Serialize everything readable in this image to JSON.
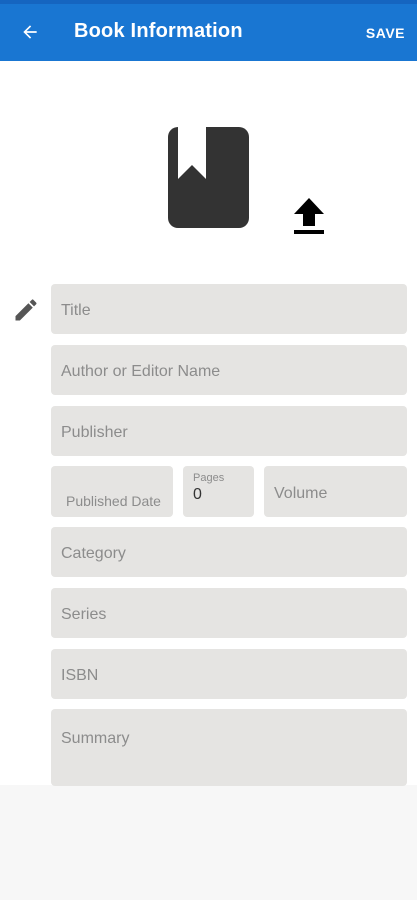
{
  "appbar": {
    "back_icon": "arrow-left-icon",
    "title": "Book Information",
    "save_label": "SAVE",
    "background": "#1976d2"
  },
  "cover": {
    "icon": "book-bookmark-icon",
    "upload_icon": "upload-icon"
  },
  "form": {
    "edit_icon": "pencil-icon",
    "title_placeholder": "Title",
    "author_placeholder": "Author or Editor Name",
    "publisher_placeholder": "Publisher",
    "published_date_placeholder": "Published Date",
    "pages_label": "Pages",
    "pages_value": "0",
    "volume_placeholder": "Volume",
    "category_placeholder": "Category",
    "series_placeholder": "Series",
    "isbn_placeholder": "ISBN",
    "summary_placeholder": "Summary"
  }
}
